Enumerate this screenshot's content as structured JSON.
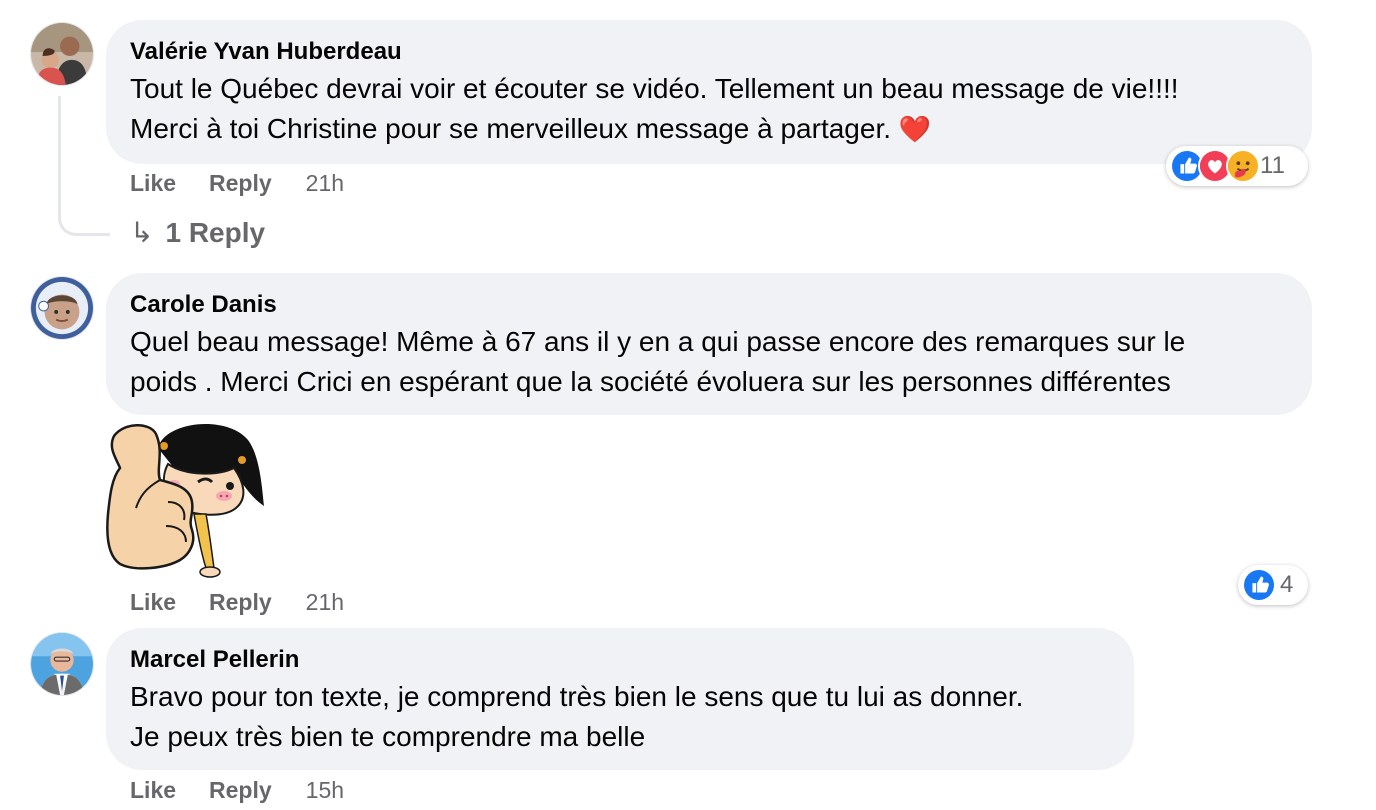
{
  "comments": [
    {
      "author": "Valérie Yvan Huberdeau",
      "line1": "Tout le Québec devrai voir et écouter se vidéo. Tellement un beau message de vie!!!!",
      "line2": "Merci à toi Christine pour se merveilleux message à partager. ",
      "emoji": "❤️",
      "like": "Like",
      "reply": "Reply",
      "time": "21h",
      "reaction_count": "11",
      "reactions": [
        "like-icon",
        "love-icon",
        "care-icon"
      ],
      "replies_link": "1 Reply"
    },
    {
      "author": "Carole Danis",
      "line1": "Quel beau message! Même à 67 ans il y en a qui passe encore des remarques sur le",
      "line2": "poids . Merci Crici en espérant que la société évoluera sur les personnes différentes",
      "sticker": "thumbs-up-girl-sticker",
      "like": "Like",
      "reply": "Reply",
      "time": "21h",
      "reaction_count": "4",
      "reactions": [
        "like-icon"
      ]
    },
    {
      "author": "Marcel Pellerin",
      "line1": "Bravo pour ton texte, je comprend très bien le sens que tu lui as donner.",
      "line2": "Je peux très bien te comprendre ma belle",
      "like": "Like",
      "reply": "Reply",
      "time": "15h"
    }
  ],
  "colors": {
    "bubble": "#f0f2f5",
    "secondary_text": "#65676b",
    "like_blue": "#1877f2",
    "love_red": "#f33e58"
  }
}
